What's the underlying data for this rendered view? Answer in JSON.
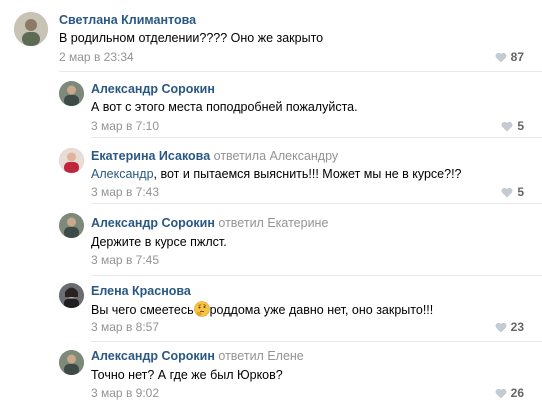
{
  "comments": [
    {
      "author": "Светлана Климантова",
      "reply_to": "",
      "text": "В родильном отделении???? Оно же закрыто",
      "time": "2 мар в 23:34",
      "likes": "87",
      "avatar": "woman-avatar"
    },
    {
      "author": "Александр Сорокин",
      "reply_to": "",
      "text": "А вот с этого места поподробней пожалуйста.",
      "time": "3 мар в 7:10",
      "likes": "5",
      "avatar": "man-avatar"
    },
    {
      "author": "Екатерина Исакова",
      "reply_to": "ответила Александру",
      "mention": "Александр",
      "text": ", вот и пытаемся выяснить!!! Может мы не в курсе?!?",
      "time": "3 мар в 7:43",
      "likes": "5",
      "avatar": "woman-red-avatar"
    },
    {
      "author": "Александр Сорокин",
      "reply_to": "ответил Екатерине",
      "text": "Держите в курсе пжлст.",
      "time": "3 мар в 7:45",
      "likes": "",
      "avatar": "man-avatar"
    },
    {
      "author": "Елена Краснова",
      "reply_to": "",
      "text_before": "Вы чего смеетесь",
      "emoji": "thinking-emoji",
      "text_after": "роддома уже давно нет, оно закрыто!!!",
      "time": "3 мар в 8:57",
      "likes": "23",
      "avatar": "woman-dark-avatar"
    },
    {
      "author": "Александр Сорокин",
      "reply_to": "ответил Елене",
      "text": "Точно нет? А где же был Юрков?",
      "time": "3 мар в 9:02",
      "likes": "26",
      "avatar": "man-avatar"
    }
  ],
  "colors": {
    "author": "#2a5885",
    "meta": "#939393",
    "likes": "#656565",
    "divider": "#e7e8ec"
  }
}
